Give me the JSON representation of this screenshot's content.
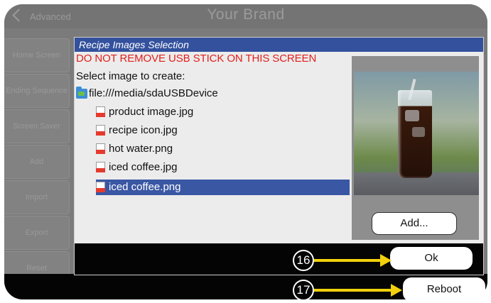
{
  "topbar": {
    "back_label": "Advanced",
    "title": "Your Brand"
  },
  "sidebar": {
    "items": [
      {
        "label": "Home Screen"
      },
      {
        "label": "Ending Sequence"
      },
      {
        "label": "Screen Saver"
      },
      {
        "label": "Add"
      },
      {
        "label": "Import"
      },
      {
        "label": "Export"
      },
      {
        "label": "Reset"
      }
    ]
  },
  "dialog": {
    "title": "Recipe Images Selection",
    "warning": "DO NOT REMOVE USB STICK ON THIS SCREEN",
    "select_label": "Select image to create:",
    "root_path": "file:///media/sdaUSBDevice",
    "files": [
      {
        "name": "product image.jpg",
        "selected": false
      },
      {
        "name": "recipe icon.jpg",
        "selected": false
      },
      {
        "name": "hot water.png",
        "selected": false
      },
      {
        "name": "iced coffee.jpg",
        "selected": false
      },
      {
        "name": "iced coffee.png",
        "selected": true
      }
    ],
    "add_label": "Add...",
    "ok_label": "Ok"
  },
  "reboot_label": "Reboot",
  "callouts": [
    {
      "number": "16",
      "target": "Ok"
    },
    {
      "number": "17",
      "target": "Reboot"
    }
  ],
  "colors": {
    "title_bar": "#33519d",
    "selection": "#3a57a4",
    "warning": "#e0201c",
    "callout_arrow": "#f2d10c"
  }
}
